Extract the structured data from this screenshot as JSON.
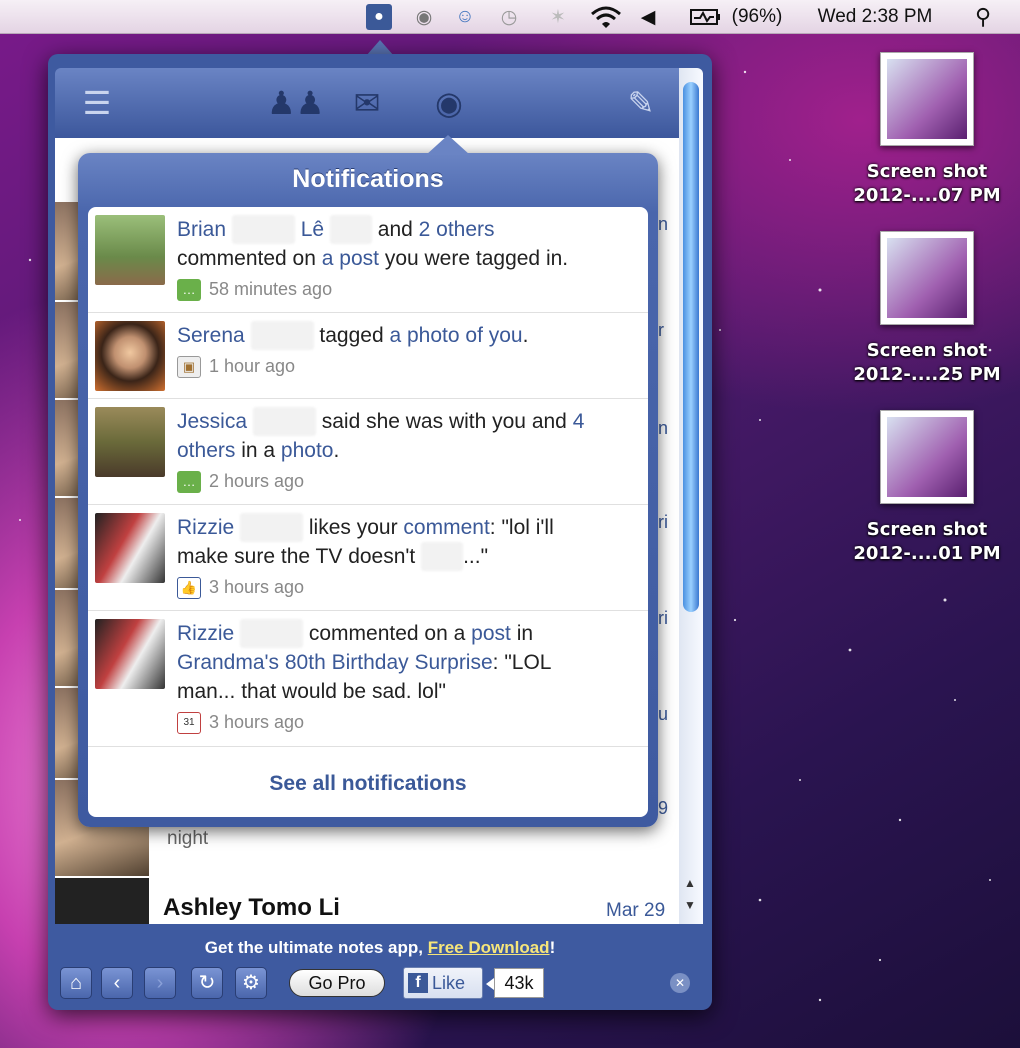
{
  "menubar": {
    "battery": "(96%)",
    "clock": "Wed 2:38 PM",
    "icons": [
      "facebook-app-icon",
      "alien-icon",
      "finder-helper-icon",
      "time-machine-icon",
      "bluetooth-icon",
      "wifi-icon",
      "volume-icon",
      "battery-icon",
      "spotlight-icon"
    ]
  },
  "desktop": {
    "icons": [
      {
        "line1": "Screen shot",
        "line2": "2012-....07 PM"
      },
      {
        "line1": "Screen shot",
        "line2": "2012-....25 PM"
      },
      {
        "line1": "Screen shot",
        "line2": "2012-....01 PM"
      }
    ]
  },
  "toolbar": {
    "icons": [
      "menu-icon",
      "friends-icon",
      "messages-icon",
      "globe-icon",
      "compose-icon"
    ]
  },
  "notifications": {
    "title": "Notifications",
    "items": [
      {
        "name": "Brian",
        "mid": "Lê",
        "pre": "and",
        "link1": "2 others",
        "text2": "commented on",
        "link2": "a post",
        "text3": "you were tagged in.",
        "time": "58 minutes ago",
        "icon": "comment-icon"
      },
      {
        "name": "Serena",
        "text1": "tagged",
        "link1": "a photo of you",
        "text2": ".",
        "time": "1 hour ago",
        "icon": "photo-icon"
      },
      {
        "name": "Jessica",
        "text1": "said she was with you and",
        "link1": "4",
        "link2": "others",
        "text2": "in a",
        "link3": "photo",
        "text3": ".",
        "time": "2 hours ago",
        "icon": "comment-icon"
      },
      {
        "name": "Rizzie",
        "text1": "likes your",
        "link1": "comment",
        "text2": ": \"lol i'll",
        "text3": "make sure the TV doesn't",
        "text4": "...\"",
        "time": "3 hours ago",
        "icon": "like-icon"
      },
      {
        "name": "Rizzie",
        "text1": "commented on a",
        "link1": "post",
        "text2": "in",
        "link2": "Grandma's 80th Birthday Surprise",
        "text3": ": \"LOL",
        "text4": "man... that would be sad. lol\"",
        "time": "3 hours ago",
        "icon": "event-icon"
      }
    ],
    "see_all": "See all notifications"
  },
  "feed": {
    "edge_letters": [
      "n",
      "r",
      "n",
      "ri",
      "ri",
      "u",
      "9"
    ],
    "night": "night",
    "last_name": "Ashley Tomo Li",
    "last_date": "Mar 29"
  },
  "promo": {
    "text": "Get the ultimate notes app,",
    "link": "Free Download",
    "suffix": "!"
  },
  "bottombar": {
    "gopro": "Go Pro",
    "like": "Like",
    "count": "43k"
  },
  "colors": {
    "facebook_blue": "#3b5998",
    "popover": "#4a66ac"
  }
}
